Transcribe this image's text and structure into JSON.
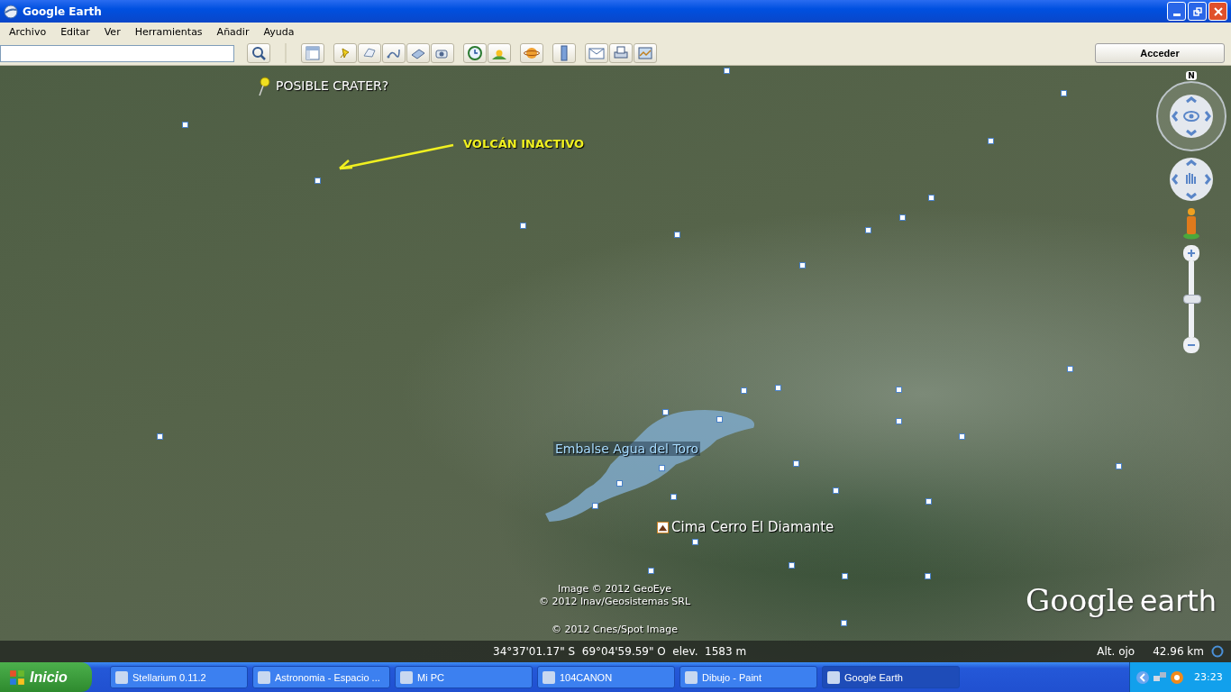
{
  "window": {
    "title": "Google Earth"
  },
  "menu": [
    "Archivo",
    "Editar",
    "Ver",
    "Herramientas",
    "Añadir",
    "Ayuda"
  ],
  "sign_in": "Acceder",
  "map_labels": [
    {
      "kind": "pin",
      "text": "POSIBLE CRATER?"
    },
    {
      "kind": "arrow",
      "text": "VOLCÁN INACTIVO"
    },
    {
      "kind": "water",
      "text": "Embalse Agua del Toro"
    },
    {
      "kind": "peak",
      "text": "Cima Cerro El Diamante"
    }
  ],
  "attribution": [
    "Image © 2012 GeoEye",
    "© 2012 Inav/Geosistemas SRL",
    "© 2012 Cnes/Spot Image"
  ],
  "logo": {
    "word_1": "Google",
    "word_2": "earth"
  },
  "compass": {
    "north": "N"
  },
  "zoom": {
    "level": 0.49
  },
  "status_bar": {
    "coordinates": "34°37'01.17\" S  69°04'59.59\" O  elev.  1583 m",
    "eye_alt_label": "Alt. ojo",
    "eye_alt": "42.96 km"
  },
  "taskbar": {
    "start": "Inicio",
    "tasks": [
      {
        "label": "Stellarium 0.11.2",
        "selected": false
      },
      {
        "label": "Astronomia - Espacio ...",
        "selected": false
      },
      {
        "label": "Mi PC",
        "selected": false
      },
      {
        "label": "104CANON",
        "selected": false
      },
      {
        "label": "Dibujo - Paint",
        "selected": false
      },
      {
        "label": "Google Earth",
        "selected": true
      }
    ],
    "clock": "23:23"
  }
}
